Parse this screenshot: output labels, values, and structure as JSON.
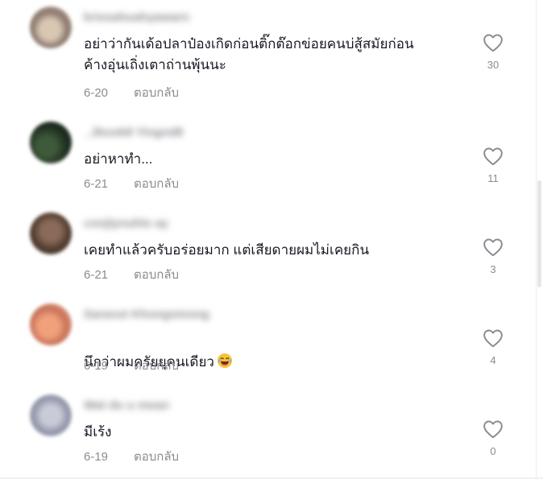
{
  "colors": {
    "text_primary": "#161823",
    "text_secondary": "#8a8b91",
    "like_outline": "#8a8b91"
  },
  "icons": {
    "like": "heart-outline-icon",
    "laugh_emoji": "tears-of-joy-emoji"
  },
  "comments": [
    {
      "username": "krissahuahyawarn",
      "text": "อย่าว่ากันเด้อปลาป๋องเกิดก่อนติ๊กต๊อกข่อยคนบ่สู้สมัยก่อน\nค้างอุ่นเถิ่งเตาถ่านพุ้นนะ",
      "date": "6-20",
      "reply": "ตอบกลับ",
      "likes": "30"
    },
    {
      "username": "_Jbook8 Yingnd8",
      "text": "อย่าหาทำ...",
      "date": "6-21",
      "reply": "ตอบกลับ",
      "likes": "11"
    },
    {
      "username": "conjlynuhlo ay",
      "text": "เคยทำแล้วครับอร่อยมาก แต่เสียดายผมไม่เคยกิน",
      "date": "6-21",
      "reply": "ตอบกลับ",
      "likes": "3"
    },
    {
      "username": "Saravut Khongsmong",
      "text": "นึกว่าผมครัยยุคนเดียว",
      "date": "6-19",
      "reply": "ตอบกลับ",
      "likes": "4"
    },
    {
      "username": "Wat du u mean",
      "text": "มีเร้ง",
      "date": "6-19",
      "reply": "ตอบกลับ",
      "likes": "0"
    }
  ]
}
